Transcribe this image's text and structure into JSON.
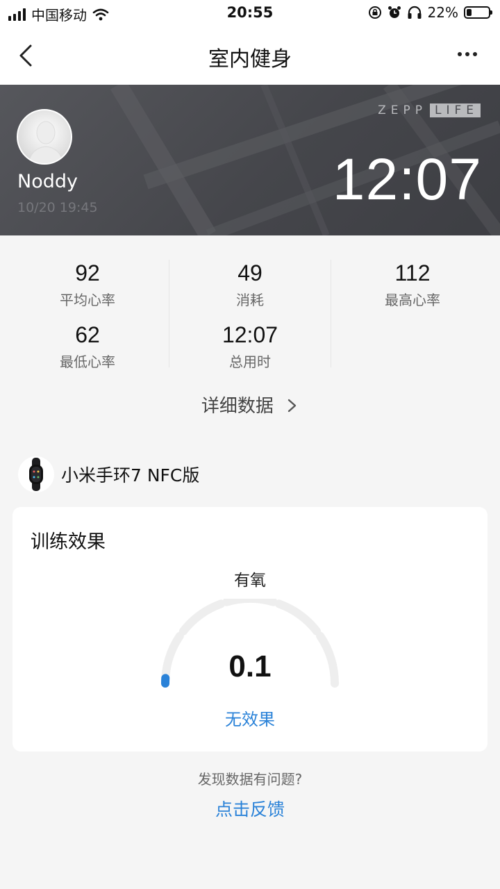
{
  "status_bar": {
    "carrier": "中国移动",
    "time": "20:55",
    "battery_percent_text": "22%",
    "battery_level": 0.22,
    "signal_bars": 4,
    "icons": [
      "signal-icon",
      "wifi-icon",
      "orientation-lock-icon",
      "alarm-icon",
      "headphones-icon",
      "battery-icon"
    ]
  },
  "nav": {
    "title": "室内健身",
    "back_icon": "chevron-left-icon",
    "more_icon": "more-dots-icon"
  },
  "hero": {
    "user_name": "Noddy",
    "date": "10/20 19:45",
    "brand_left": "ZEPP",
    "brand_right": "LIFE",
    "duration": "12:07"
  },
  "stats": {
    "avg_heart_rate": {
      "value": "92",
      "label": "平均心率"
    },
    "calories": {
      "value": "49",
      "label": "消耗"
    },
    "max_heart_rate": {
      "value": "112",
      "label": "最高心率"
    },
    "min_heart_rate": {
      "value": "62",
      "label": "最低心率"
    },
    "total_time": {
      "value": "12:07",
      "label": "总用时"
    }
  },
  "detail_link": "详细数据",
  "device": {
    "name": "小米手环7 NFC版",
    "icon": "band-icon"
  },
  "training_effect": {
    "title": "训练效果",
    "type": "有氧",
    "value": "0.1",
    "value_numeric": 0.1,
    "scale_max": 5.0,
    "level": "无效果",
    "colors": {
      "accent": "#2a82d8",
      "track": "#eeeeee"
    }
  },
  "feedback": {
    "question": "发现数据有问题?",
    "link": "点击反馈"
  }
}
